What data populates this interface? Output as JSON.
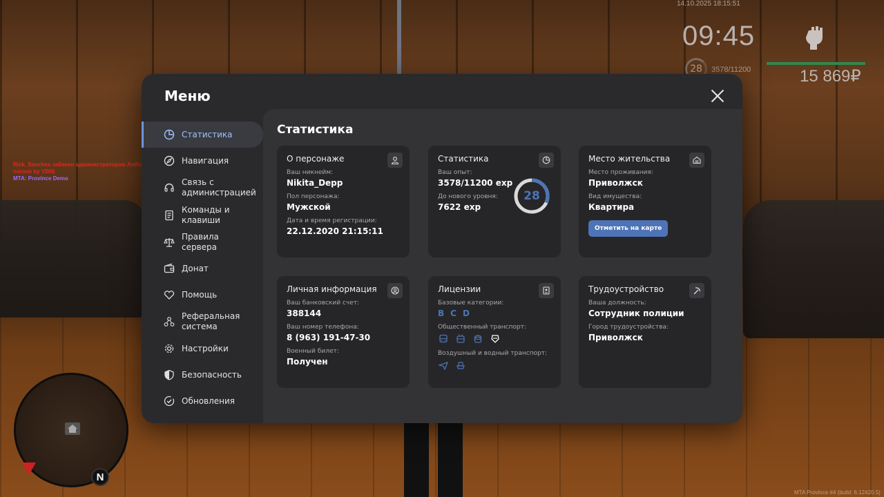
{
  "hud": {
    "datetime": "14.10.2025 18:15:51",
    "clock": "09:45",
    "level": "28",
    "exp": "3578/11200",
    "money": "15 869₽",
    "chat_line1": "Rick_Sanches забанен администратором Anthony_Manrique (6 дн. ) ~ читер",
    "chat_line2": "погоне by VBN)",
    "chat_line3": "MTA: Province Demo",
    "build": "MTA Province #4 (build: 6.12420.5)",
    "minimap_north": "N"
  },
  "menu": {
    "title": "Меню",
    "sidebar": [
      {
        "label": "Статистика"
      },
      {
        "label": "Навигация"
      },
      {
        "label": "Связь с администрацией"
      },
      {
        "label": "Команды и клавиши"
      },
      {
        "label": "Правила сервера"
      },
      {
        "label": "Донат"
      },
      {
        "label": "Помощь"
      },
      {
        "label": "Реферальная система"
      },
      {
        "label": "Настройки"
      },
      {
        "label": "Безопасность"
      },
      {
        "label": "Обновления"
      }
    ],
    "content_title": "Статистика",
    "cards": {
      "character": {
        "title": "О персонаже",
        "nick_label": "Ваш никнейм:",
        "nick": "Nikita_Depp",
        "gender_label": "Пол персонажа:",
        "gender": "Мужской",
        "reg_label": "Дата и время регистрации:",
        "reg": "22.12.2020 21:15:11"
      },
      "stats": {
        "title": "Статистика",
        "exp_label": "Ваш опыт:",
        "exp": "3578/11200 exp",
        "next_label": "До нового уровня:",
        "next": "7622 exp",
        "level": "28",
        "progress": 0.319
      },
      "residence": {
        "title": "Место жительства",
        "place_label": "Место проживания:",
        "place": "Приволжск",
        "type_label": "Вид имущества:",
        "type": "Квартира",
        "button": "Отметить на карте"
      },
      "personal": {
        "title": "Личная информация",
        "bank_label": "Ваш банковский счет:",
        "bank": "388144",
        "phone_label": "Ваш номер телефона:",
        "phone": "8 (963) 191-47-30",
        "military_label": "Военный билет:",
        "military": "Получен"
      },
      "licenses": {
        "title": "Лицензии",
        "basic_label": "Базовые категории:",
        "basic": [
          "B",
          "C",
          "D"
        ],
        "public_label": "Общественный транспорт:",
        "public_icons": [
          "bus-icon",
          "trolleybus-icon",
          "tram-icon",
          "metro-icon"
        ],
        "air_label": "Воздушный и водный транспорт:",
        "air_icons": [
          "plane-icon",
          "boat-icon"
        ]
      },
      "employment": {
        "title": "Трудоустройство",
        "position_label": "Ваша должность:",
        "position": "Сотрудник полиции",
        "city_label": "Город трудоустройства:",
        "city": "Приволжск"
      }
    }
  },
  "colors": {
    "accent": "#4d74b6",
    "active_text": "#9ec2ff",
    "window_bg": "#2a2a2d",
    "card_bg": "#262628",
    "hp_bar": "#2f8a4f"
  }
}
